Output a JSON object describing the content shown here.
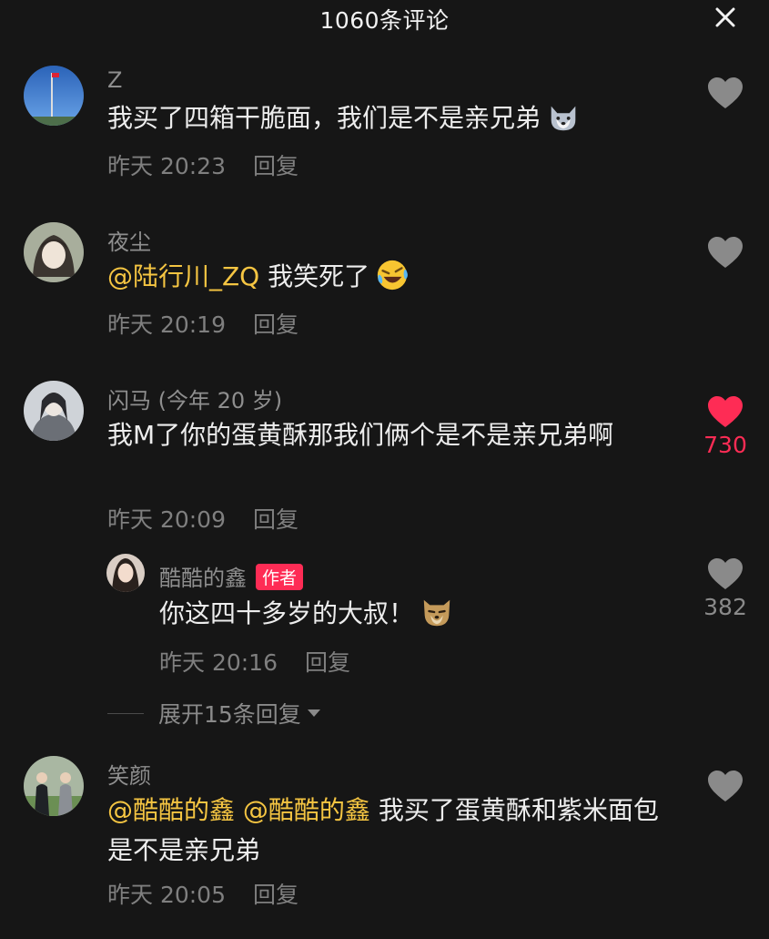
{
  "header": {
    "title": "1060条评论",
    "close_icon": "close-icon"
  },
  "comments": [
    {
      "username": "Z",
      "text": "我买了四箱干脆面，我们是不是亲兄弟",
      "emoji": "husky-dog-emoji",
      "time": "昨天 20:23",
      "reply": "回复",
      "liked": false,
      "likes": ""
    },
    {
      "username": "夜尘",
      "mention": "@陆行川_ZQ",
      "text": " 我笑死了",
      "emoji": "rolling-laughing-emoji",
      "time": "昨天 20:19",
      "reply": "回复",
      "liked": false,
      "likes": ""
    },
    {
      "username": "闪马 (今年 20 岁)",
      "text": "我M了你的蛋黄酥那我们俩个是不是亲兄弟啊",
      "time": "昨天 20:09",
      "reply": "回复",
      "liked": true,
      "likes": "730",
      "like_color": "#fe2c55"
    },
    {
      "username": "酷酷的鑫",
      "badge": "作者",
      "text": "你这四十多岁的大叔！",
      "emoji": "dog-face-emoji",
      "time": "昨天 20:16",
      "reply": "回复",
      "liked": false,
      "likes": "382"
    },
    {
      "username": "笑颜",
      "mention1": "@酷酷的鑫",
      "mention2": "@酷酷的鑫",
      "text": " 我买了蛋黄酥和紫米面包 是不是亲兄弟",
      "time": "昨天 20:05",
      "reply": "回复",
      "liked": false,
      "likes": ""
    }
  ],
  "expand_replies": "展开15条回复",
  "colors": {
    "background": "#161616",
    "mention": "#f5c542",
    "like_active": "#fe2c55",
    "badge": "#fe2c55"
  }
}
